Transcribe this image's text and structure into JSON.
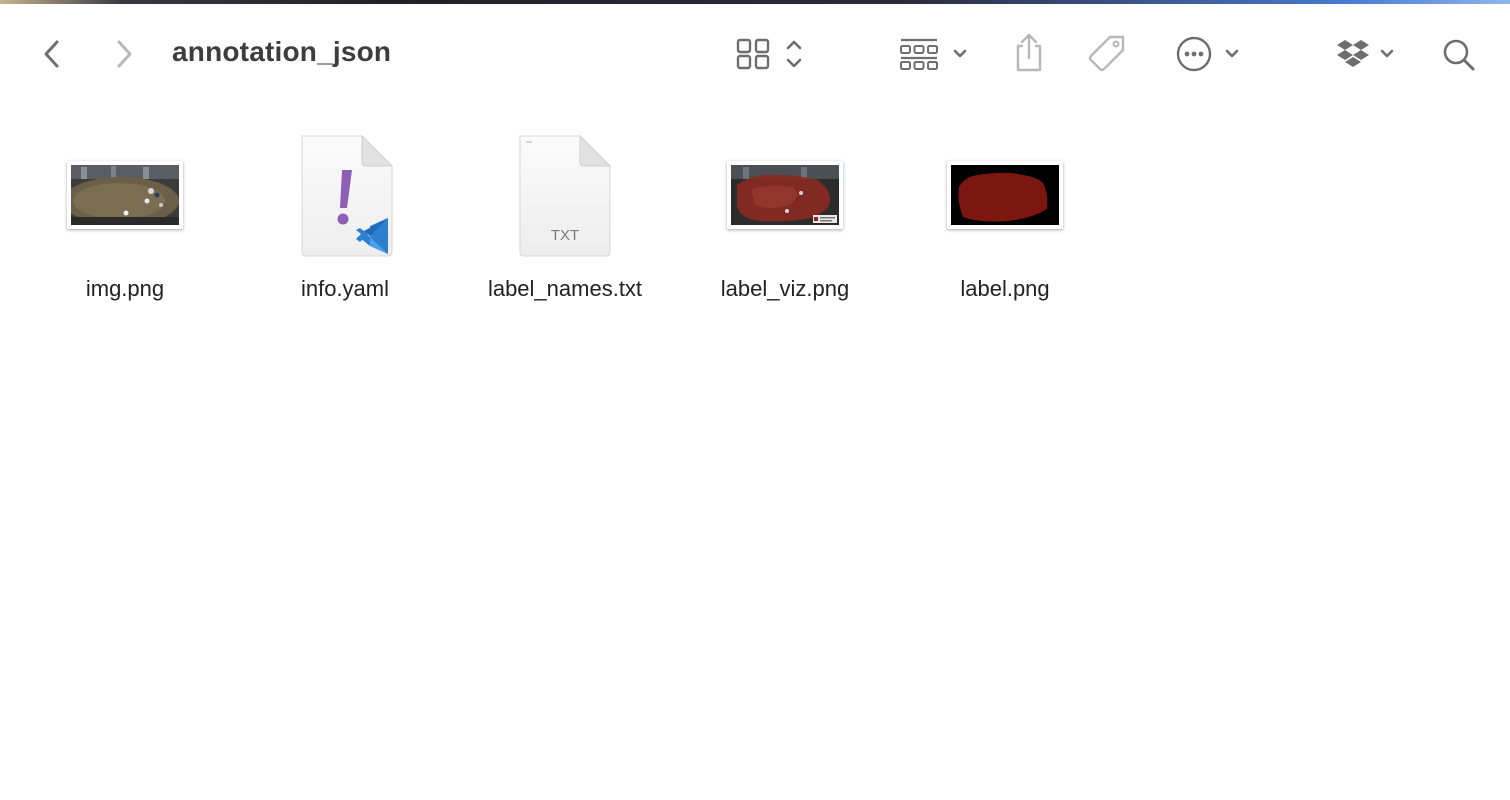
{
  "window": {
    "title": "annotation_json"
  },
  "toolbar": {
    "back_icon": "chevron-left-icon",
    "forward_icon": "chevron-right-icon",
    "view_icon": "icon-grid-view-icon",
    "group_icon": "group-by-icon",
    "share_icon": "share-icon",
    "tag_icon": "tag-icon",
    "more_icon": "ellipsis-circle-icon",
    "dropbox_icon": "dropbox-icon",
    "search_icon": "search-icon"
  },
  "files": [
    {
      "name": "img.png",
      "kind": "image-thumbnail"
    },
    {
      "name": "info.yaml",
      "kind": "yaml-vscode-document"
    },
    {
      "name": "label_names.txt",
      "kind": "text-document",
      "badge": "TXT"
    },
    {
      "name": "label_viz.png",
      "kind": "image-thumbnail-overlay"
    },
    {
      "name": "label.png",
      "kind": "image-thumbnail-mask"
    }
  ],
  "colors": {
    "title": "#3d3d3d",
    "icon": "#6e6e6e",
    "icon_disabled": "#b8b8b8",
    "yaml_mark": "#8e5fb5",
    "vscode_blue": "#2f7fd0",
    "label_red": "#7b1710"
  }
}
